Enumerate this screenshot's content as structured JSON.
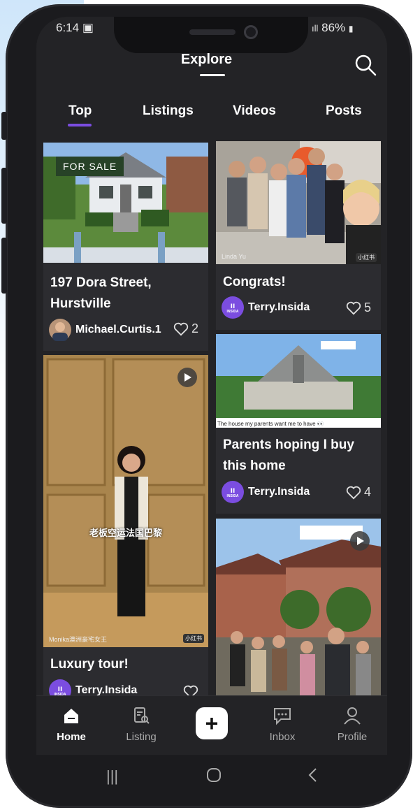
{
  "status": {
    "time": "6:14",
    "battery": "86%"
  },
  "header": {
    "title": "Explore"
  },
  "tabs": [
    {
      "label": "Top",
      "active": true
    },
    {
      "label": "Listings"
    },
    {
      "label": "Videos"
    },
    {
      "label": "Posts"
    }
  ],
  "posts": {
    "p1": {
      "badge": "FOR SALE",
      "title_line1": "197 Dora Street,",
      "title_line2": "Hurstville",
      "author": "Michael.Curtis.1",
      "likes": "2"
    },
    "p2": {
      "title": "Congrats!",
      "author": "Terry.Insida",
      "likes": "5",
      "watermark": "Linda Yu",
      "platform_tag": "小红书"
    },
    "p3": {
      "caption": "The house my parents want me to have 👀",
      "title_line1": "Parents hoping I buy",
      "title_line2": "this home",
      "author": "Terry.Insida",
      "likes": "4"
    },
    "p4": {
      "subtitle": "老板空运法国巴黎",
      "watermark": "Monika澳洲豪宅女王",
      "platform_tag": "小红书",
      "title": "Luxury tour!",
      "author": "Terry.Insida"
    },
    "p5": {}
  },
  "avatar_text": "INSIDA",
  "bottom_nav": {
    "home": "Home",
    "listing": "Listing",
    "inbox": "Inbox",
    "profile": "Profile"
  },
  "colors": {
    "accent": "#7b4de0",
    "background": "#232326",
    "card": "#2c2c30"
  }
}
